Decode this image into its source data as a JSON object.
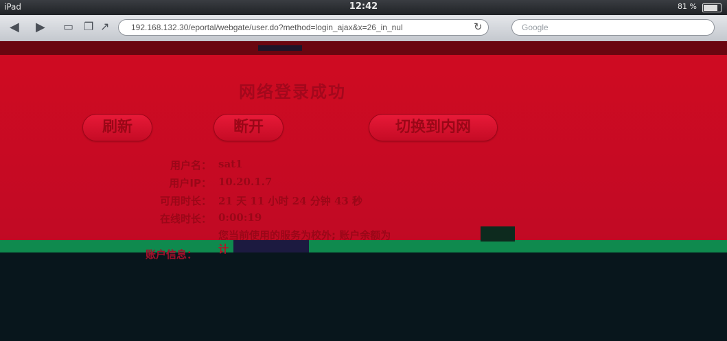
{
  "status_bar": {
    "carrier": "iPad",
    "time": "12:42",
    "battery": "81 %"
  },
  "browser": {
    "url": "192.168.132.30/eportal/webgate/user.do?method=login_ajax&x=26_in_nul",
    "search_placeholder": "Google",
    "icons": [
      "back-arrow-icon",
      "forward-arrow-icon",
      "bookmarks-icon",
      "tabs-icon",
      "share-icon",
      "reload-icon"
    ]
  },
  "page": {
    "title": "网络登录成功",
    "buttons": {
      "refresh": "刷新",
      "disconnect": "断开",
      "switch": "切换到内网"
    },
    "info": {
      "username_label": "用户名：",
      "username_value": "sat1",
      "ip_label": "用户IP：",
      "ip_value": "10.20.1.7",
      "available_label": "可用时长：",
      "available_value": "21 天 11 小时 24 分钟 43 秒",
      "used_label": "在线时长：",
      "used_value": "0:00:19",
      "note": "您当前使用的服务为校外; 账户余额为",
      "account_label": "账户信息：",
      "account_value": "计"
    }
  },
  "colors": {
    "page_bg": "#cf0b22",
    "text_dark_red": "#9a0718",
    "toolbar": "#d6d9de"
  }
}
